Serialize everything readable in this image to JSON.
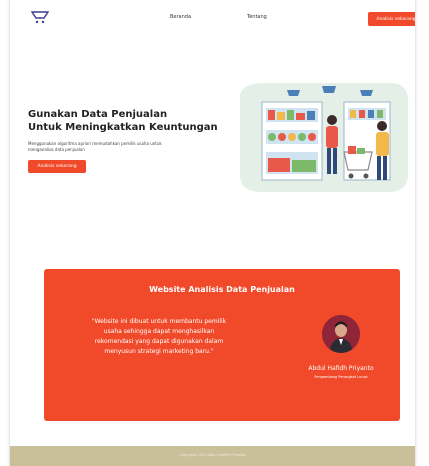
{
  "nav": {
    "links": [
      "Beranda",
      "Tentang"
    ],
    "cta_label": "Analisis sekarang"
  },
  "hero": {
    "title_line1": "Gunakan Data Penjualan",
    "title_line2": "Untuk Meningkatkan Keuntungan",
    "description": "Menggunakan algoritma apriori memudahkan pemilik usaha untuk menganalisa data penjualan",
    "button_label": "Analisis sekarang"
  },
  "card": {
    "title": "Website Analisis Data Penjualan",
    "quote": "\"Website ini dibuat untuk membantu pemilik usaha sehingga dapat menghasilkan rekomendasi yang dapat digunakan dalam menyusun strategi marketing baru.\"",
    "person_name": "Abdul Hafidh Priyanto",
    "person_role": "Pengembang Perangkat Lunak"
  },
  "footer": {
    "text": "Copyright 2023 Abdul Hafidh Priyanto"
  },
  "colors": {
    "accent": "#f04a2a",
    "footer": "#c9c09a",
    "illustration_bg": "#e4efe8"
  },
  "icons": {
    "logo": "cart-logo-icon"
  }
}
